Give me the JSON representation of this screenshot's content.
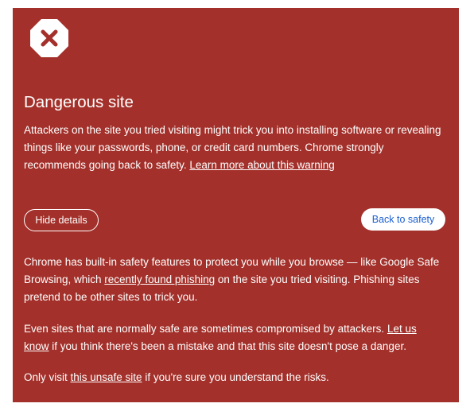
{
  "warning": {
    "icon": "danger-x-icon",
    "title": "Dangerous site",
    "intro_text": "Attackers on the site you tried visiting might trick you into installing software or revealing things like your passwords, phone, or credit card numbers. Chrome strongly recommends going back to safety. ",
    "learn_more_link": "Learn more about this warning",
    "hide_details_label": "Hide details",
    "back_to_safety_label": "Back to safety",
    "details_1_before": "Chrome has built-in safety features to protect you while you browse — like Google Safe Browsing, which ",
    "details_1_link": "recently found phishing",
    "details_1_after": " on the site you tried visiting. Phishing sites pretend to be other sites to trick you.",
    "details_2_before": "Even sites that are normally safe are sometimes compromised by attackers. ",
    "details_2_link": "Let us know",
    "details_2_after": " if you think there's been a mistake and that this site doesn't pose a danger.",
    "details_3_before": "Only visit ",
    "details_3_link": "this unsafe site",
    "details_3_after": " if you're sure you understand the risks."
  },
  "colors": {
    "background": "#a3302a",
    "text": "#ffffff",
    "button_link": "#1a5fd1"
  }
}
